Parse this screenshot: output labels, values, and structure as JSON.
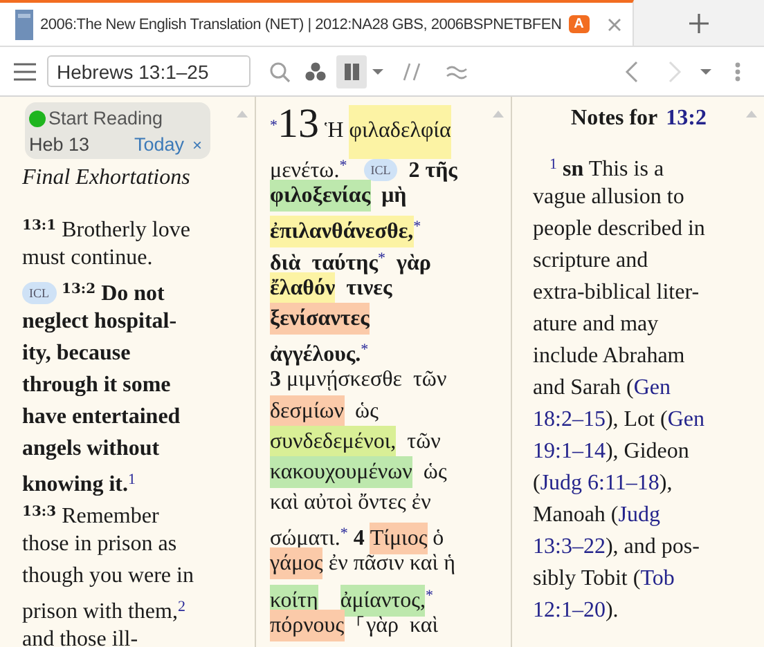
{
  "tab": {
    "title": "2006:The New English Translation (NET) | 2012:NA28 GBS, 2006BSPNETBFEN",
    "badge": "A"
  },
  "toolbar": {
    "reference": "Hebrews 13:1–25",
    "tools": [
      {
        "kind": "search",
        "selected": false,
        "disabled": false
      },
      {
        "kind": "cluster",
        "selected": false,
        "disabled": false
      },
      {
        "kind": "columns",
        "selected": true,
        "disabled": false
      },
      {
        "kind": "caret",
        "selected": false,
        "disabled": false
      },
      {
        "kind": "parallel",
        "selected": false,
        "disabled": false
      },
      {
        "kind": "approx",
        "selected": false,
        "disabled": false
      }
    ],
    "nav": [
      {
        "kind": "back",
        "selected": false,
        "disabled": false
      },
      {
        "kind": "forward",
        "selected": false,
        "disabled": true
      },
      {
        "kind": "caret",
        "selected": false,
        "disabled": false
      },
      {
        "kind": "more",
        "selected": false,
        "disabled": false
      }
    ]
  },
  "reading_plan": {
    "label": "Start Reading",
    "reference": "Heb 13",
    "date": "Today",
    "close": "×"
  },
  "english_pane": {
    "heading": "Final Exhortations",
    "lines": [
      [
        {
          "kind": "verse",
          "text": "13:1"
        },
        {
          "kind": "text",
          "text": " Brotherly love",
          "bold": false
        }
      ],
      [
        {
          "kind": "text",
          "text": "must continue.",
          "bold": false
        }
      ],
      [
        {
          "kind": "badge",
          "text": "ICL"
        },
        {
          "kind": "verse",
          "text": "13:2"
        },
        {
          "kind": "text",
          "text": " Do not",
          "bold": true
        }
      ],
      [
        {
          "kind": "text",
          "text": "neglect hospital-",
          "bold": true
        }
      ],
      [
        {
          "kind": "text",
          "text": "ity, because",
          "bold": true
        }
      ],
      [
        {
          "kind": "text",
          "text": "through it some",
          "bold": true
        }
      ],
      [
        {
          "kind": "text",
          "text": "have entertained",
          "bold": true
        }
      ],
      [
        {
          "kind": "text",
          "text": "angels without",
          "bold": true
        }
      ],
      [
        {
          "kind": "text",
          "text": "knowing it.",
          "bold": true
        },
        {
          "kind": "mark",
          "text": "1"
        }
      ],
      [
        {
          "kind": "verse",
          "text": "13:3"
        },
        {
          "kind": "text",
          "text": " Remember",
          "bold": false
        }
      ],
      [
        {
          "kind": "text",
          "text": "those in prison as",
          "bold": false
        }
      ],
      [
        {
          "kind": "text",
          "text": "though you were in",
          "bold": false
        }
      ],
      [
        {
          "kind": "text",
          "text": "prison with them,",
          "bold": false
        },
        {
          "kind": "mark",
          "text": "2"
        }
      ],
      [
        {
          "kind": "text",
          "text": "and those ill-",
          "bold": false
        }
      ]
    ]
  },
  "greek_pane": {
    "lines": [
      [
        {
          "kind": "mark",
          "text": "*"
        },
        {
          "kind": "chapter",
          "text": "13"
        },
        {
          "kind": "text",
          "text": " Ἡ ",
          "bold": false
        },
        {
          "kind": "text",
          "text": "φιλαδελφία",
          "bold": false,
          "color": "#fcf3a4"
        }
      ],
      [
        {
          "kind": "text",
          "text": "μενέτω.",
          "bold": false
        },
        {
          "kind": "mark",
          "text": "*"
        },
        {
          "kind": "badge",
          "text": "ICL"
        },
        {
          "kind": "text",
          "text": " 2 τῆς",
          "bold": true
        }
      ],
      [
        {
          "kind": "text",
          "text": "φιλοξενίας",
          "bold": true,
          "color": "#bde8ad"
        },
        {
          "kind": "text",
          "text": "  μὴ",
          "bold": true
        }
      ],
      [
        {
          "kind": "text",
          "text": "ἐπιλανθάνεσθε,",
          "bold": true,
          "color": "#fcf3a4"
        },
        {
          "kind": "mark",
          "text": "*"
        }
      ],
      [
        {
          "kind": "text",
          "text": "διὰ  ταύτης",
          "bold": true
        },
        {
          "kind": "mark",
          "text": "*"
        },
        {
          "kind": "text",
          "text": "  γὰρ",
          "bold": true
        }
      ],
      [
        {
          "kind": "text",
          "text": "ἔλαθόν",
          "bold": true,
          "color": "#fcf3a4"
        },
        {
          "kind": "text",
          "text": "  τινες",
          "bold": true
        }
      ],
      [
        {
          "kind": "text",
          "text": "ξενίσαντες",
          "bold": true,
          "color": "#fbcaa9"
        }
      ],
      [
        {
          "kind": "text",
          "text": "ἀγγέλους.",
          "bold": true
        },
        {
          "kind": "mark",
          "text": "*"
        }
      ],
      [
        {
          "kind": "text",
          "text": "3",
          "bold": true
        },
        {
          "kind": "text",
          "text": " μιμνῄσκεσθε  τῶν",
          "bold": false
        }
      ],
      [
        {
          "kind": "text",
          "text": "δεσμίων",
          "bold": false,
          "color": "#fbcaa9"
        },
        {
          "kind": "text",
          "text": "  ὡς",
          "bold": false
        }
      ],
      [
        {
          "kind": "text",
          "text": "συνδεδεμένοι,",
          "bold": false,
          "color": "#d9ef96"
        },
        {
          "kind": "text",
          "text": "  τῶν",
          "bold": false
        }
      ],
      [
        {
          "kind": "text",
          "text": "κακουχουμένων",
          "bold": false,
          "color": "#bde8ad"
        },
        {
          "kind": "text",
          "text": "  ὡς",
          "bold": false
        }
      ],
      [
        {
          "kind": "text",
          "text": "καὶ αὐτοὶ ὄντες ἐν",
          "bold": false
        }
      ],
      [
        {
          "kind": "text",
          "text": "σώματι.",
          "bold": false
        },
        {
          "kind": "mark",
          "text": "*"
        },
        {
          "kind": "text",
          "text": " 4 ",
          "bold": true
        },
        {
          "kind": "text",
          "text": "Τίμιος",
          "bold": false,
          "color": "#fbcaa9"
        },
        {
          "kind": "text",
          "text": " ὁ",
          "bold": false
        }
      ],
      [
        {
          "kind": "text",
          "text": "γάμος",
          "bold": false,
          "color": "#fbcaa9"
        },
        {
          "kind": "text",
          "text": " ἐν πᾶσιν καὶ ἡ",
          "bold": false
        }
      ],
      [
        {
          "kind": "text",
          "text": "κοίτη",
          "bold": false,
          "color": "#bde8ad"
        },
        {
          "kind": "text",
          "text": "ἀμίαντος,",
          "bold": false,
          "color": "#bde8ad"
        },
        {
          "kind": "mark",
          "text": "*"
        }
      ],
      [
        {
          "kind": "text",
          "text": "πόρνους",
          "bold": false,
          "color": "#fbcaa9"
        },
        {
          "kind": "text",
          "text": "  ⸀γὰρ  καὶ",
          "bold": false
        }
      ]
    ]
  },
  "notes_pane": {
    "title": "Notes for",
    "reference": "13:2",
    "lines": [
      [
        {
          "kind": "mark",
          "text": "1"
        },
        {
          "kind": "text",
          "text": " sn",
          "bold": true
        },
        {
          "kind": "text",
          "text": " This is a",
          "bold": false
        }
      ],
      [
        {
          "kind": "text",
          "text": "vague allusion to",
          "bold": false
        }
      ],
      [
        {
          "kind": "text",
          "text": "people described in",
          "bold": false
        }
      ],
      [
        {
          "kind": "text",
          "text": "scripture and",
          "bold": false
        }
      ],
      [
        {
          "kind": "text",
          "text": "extra-biblical liter-",
          "bold": false
        }
      ],
      [
        {
          "kind": "text",
          "text": "ature and may",
          "bold": false
        }
      ],
      [
        {
          "kind": "text",
          "text": "include Abraham",
          "bold": false
        }
      ],
      [
        {
          "kind": "text",
          "text": "and Sarah (",
          "bold": false
        },
        {
          "kind": "link",
          "text": "Gen"
        }
      ],
      [
        {
          "kind": "link",
          "text": "18:2–15"
        },
        {
          "kind": "text",
          "text": "), Lot (",
          "bold": false
        },
        {
          "kind": "link",
          "text": "Gen"
        }
      ],
      [
        {
          "kind": "link",
          "text": "19:1–14"
        },
        {
          "kind": "text",
          "text": "), Gideon",
          "bold": false
        }
      ],
      [
        {
          "kind": "text",
          "text": "(",
          "bold": false
        },
        {
          "kind": "link",
          "text": "Judg 6:11–18"
        },
        {
          "kind": "text",
          "text": "),",
          "bold": false
        }
      ],
      [
        {
          "kind": "text",
          "text": "Manoah (",
          "bold": false
        },
        {
          "kind": "link",
          "text": "Judg"
        }
      ],
      [
        {
          "kind": "link",
          "text": "13:3–22"
        },
        {
          "kind": "text",
          "text": "), and pos-",
          "bold": false
        }
      ],
      [
        {
          "kind": "text",
          "text": "sibly Tobit (",
          "bold": false
        },
        {
          "kind": "link",
          "text": "Tob"
        }
      ],
      [
        {
          "kind": "link",
          "text": "12:1–20"
        },
        {
          "kind": "text",
          "text": ").",
          "bold": false
        }
      ]
    ]
  }
}
